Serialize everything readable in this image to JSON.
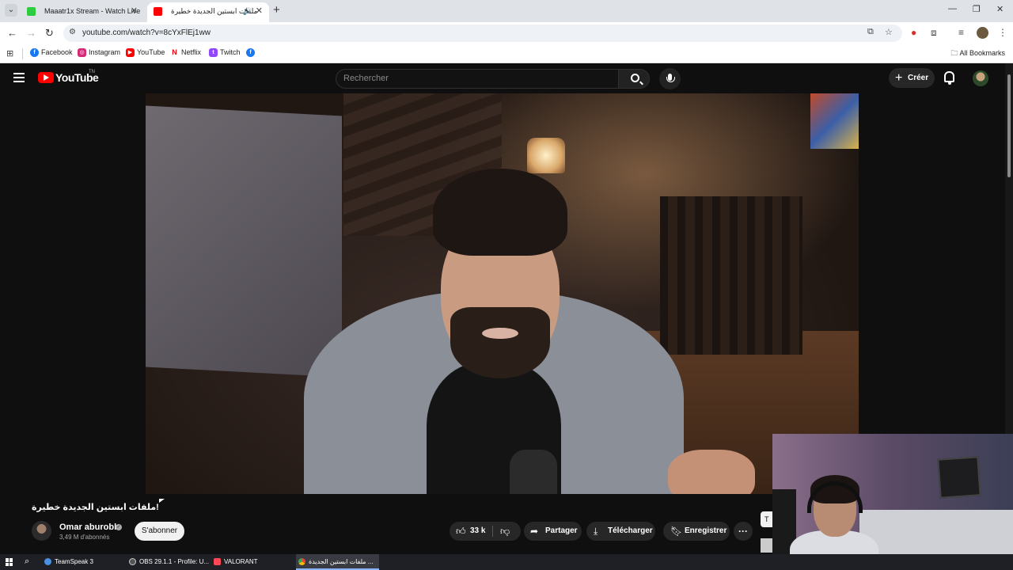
{
  "browser": {
    "tabs": [
      {
        "title": "Maaatr1x Stream - Watch Live",
        "favicon_color": "#2ecc40",
        "active": false
      },
      {
        "title": "ملفات ابستين الجديدة خطيرة",
        "favicon_color": "#ff0000",
        "active": true,
        "audio": "🔊"
      }
    ],
    "new_tab": "+",
    "url": "youtube.com/watch?v=8cYxFlEj1ww",
    "window_controls": [
      "—",
      "❐",
      "✕"
    ],
    "bookmarks": [
      {
        "label": "Facebook",
        "color": "#1877f2",
        "glyph": "f"
      },
      {
        "label": "Instagram",
        "color": "#d62976",
        "glyph": "◎"
      },
      {
        "label": "YouTube",
        "color": "#ff0000",
        "glyph": "▶"
      },
      {
        "label": "Netflix",
        "color": "#e50914",
        "glyph": "N"
      },
      {
        "label": "Twitch",
        "color": "#9146ff",
        "glyph": "t"
      }
    ],
    "all_bookmarks": "All Bookmarks"
  },
  "youtube": {
    "logo_text": "YouTube",
    "country_code": "TN",
    "search_placeholder": "Rechercher",
    "create_label": "Créer",
    "video": {
      "title": "!ملفات ابستين الجديدة خطيرة",
      "channel": "Omar aburobb",
      "subscribers": "3,49 M d'abonnés",
      "subscribe_label": "S'abonner",
      "likes": "33 k",
      "share_label": "Partager",
      "download_label": "Télécharger",
      "save_label": "Enregistrer",
      "more_label": "···",
      "side_chip": "T"
    }
  },
  "taskbar": {
    "apps": [
      {
        "label": "TeamSpeak 3",
        "color": "#4a90e2"
      },
      {
        "label": "OBS 29.1.1 - Profile: U...",
        "color": "#555555"
      },
      {
        "label": "VALORANT",
        "color": "#ff4655"
      },
      {
        "label": "ملفات ابستين الجديدة ...",
        "color": "#4caf50",
        "active": true
      }
    ]
  }
}
